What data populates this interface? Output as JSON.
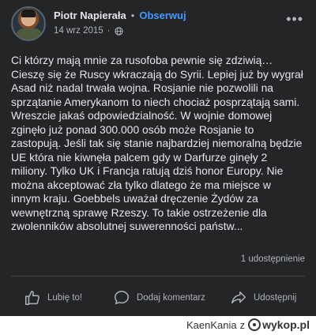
{
  "post": {
    "author": "Piotr Napierała",
    "separator": "•",
    "follow_label": "Obserwuj",
    "date": "14 wrz 2015",
    "meta_separator": "·",
    "visibility_icon": "globe-icon",
    "more_icon": "more-options-icon",
    "body_lines": [
      "Ci którzy mają mnie za rusofoba pewnie się zdziwią…",
      "Cieszę się że Ruscy wkraczają do Syrii. Lepiej już by wygrał",
      "Asad niż nadal trwała wojna. Rosjanie nie pozwolili na",
      "sprzątanie Amerykanom to niech chociaż posprzątają sami.",
      "Wreszcie jakaś odpowiedzialność. W wojnie domowej",
      "zginęło już ponad 300.000 osób może Rosjanie to",
      "zastopują. Jeśli tak się stanie najbardziej niemoralną będzie",
      "UE która nie kiwnęła palcem gdy w Darfurze ginęły 2",
      "miliony. Tylko UK i Francja ratują dziś honor Europy. Nie",
      "można akceptować zła tylko dlatego że ma miejsce w",
      "innym kraju. Goebbels uważał dręczenie Żydów za",
      "wewnętrzną sprawę Rzeszy. To takie ostrzeżenie dla",
      "zwolenników absolutnej suwerenności państw..."
    ],
    "shares_text": "1 udostępnienie"
  },
  "actions": {
    "like_label": "Lubię to!",
    "comment_label": "Dodaj komentarz",
    "share_label": "Udostępnij"
  },
  "colors": {
    "background": "#242526",
    "text": "#e4e6eb",
    "secondary": "#b0b3b8",
    "accent": "#4599ff"
  },
  "watermark": {
    "user": "KaenKania",
    "connector": "z",
    "site": "wykop.pl"
  }
}
